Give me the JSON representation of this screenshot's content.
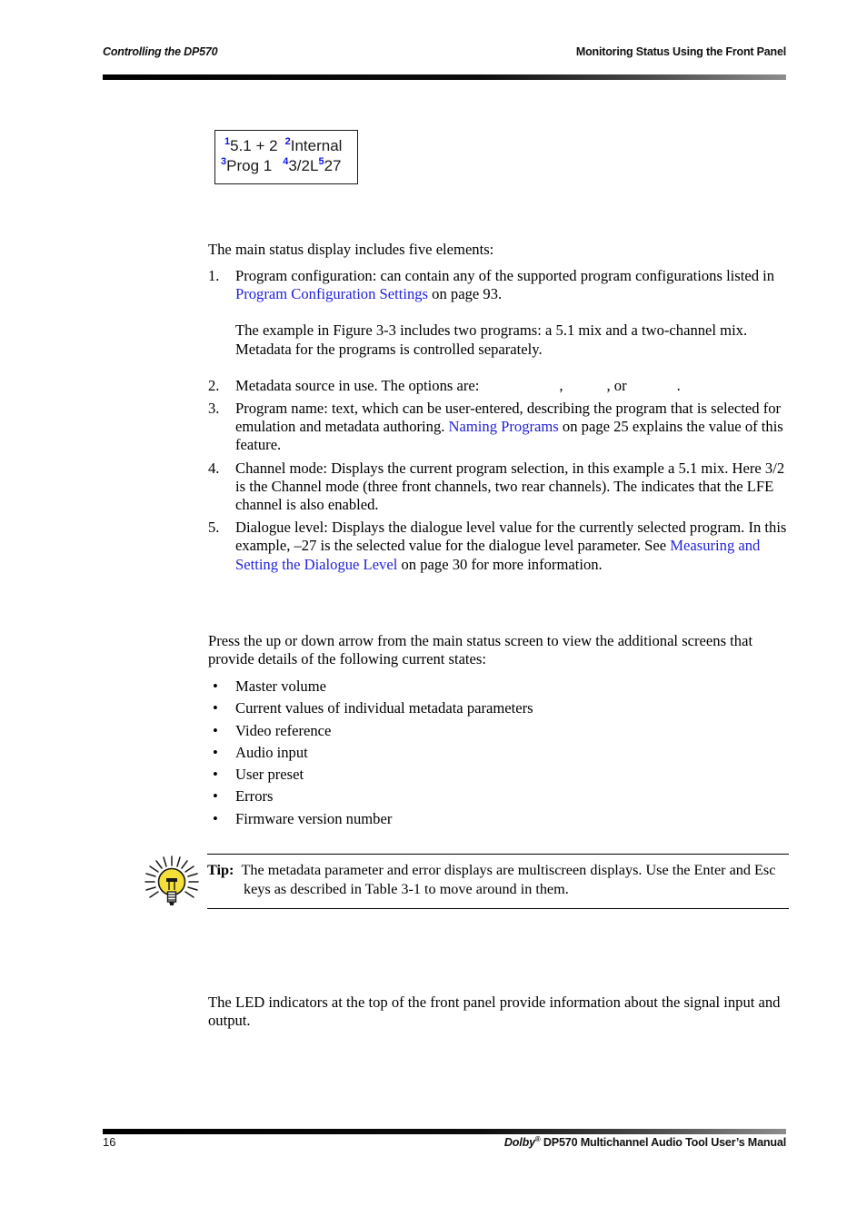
{
  "header": {
    "left": "Controlling the DP570",
    "right": "Monitoring Status Using the Front Panel"
  },
  "figure": {
    "name": "main-status-display",
    "line1": {
      "callout1": "1",
      "text1": "5.1 + 2",
      "callout2": "2",
      "text2": "Internal"
    },
    "line2": {
      "callout3": "3",
      "text3": "Prog 1",
      "callout4": "4",
      "text4": "3/2L",
      "callout5": "5",
      "text5": "27"
    }
  },
  "lead_in": "The main status display includes five elements:",
  "numbered_list": [
    {
      "num": "1.",
      "text_before_link": "Program configuration: can contain any of the supported program configurations listed in ",
      "link": "Program Configuration Settings",
      "text_after_link": " on page 93.",
      "sub_paragraph": "The example in Figure 3-3 includes two programs: a 5.1 mix and a two-channel mix. Metadata for the programs is controlled separately."
    },
    {
      "num": "2.",
      "text_before_link": "Metadata source in use. The options are:",
      "option1": "",
      "separator1": ",",
      "option2": "",
      "separator2": ", or",
      "option3": "",
      "terminator": "."
    },
    {
      "num": "3.",
      "text_before_link": "Program name: text, which can be user-entered, describing the program that is selected for emulation and metadata authoring. ",
      "link": "Naming Programs",
      "text_after_link": " on page 25 explains the value of this feature."
    },
    {
      "num": "4.",
      "text_before_link": "Channel mode: Displays the current program selection, in this example a 5.1 mix. Here 3/2 is the Channel mode (three front channels, two rear channels). The ",
      "text_after_link": " indicates that the LFE channel is also enabled."
    },
    {
      "num": "5.",
      "text_before_link": "Dialogue level: Displays the dialogue level value for the currently selected program. In this example, –27 is the selected value for the dialogue level parameter. See ",
      "link": "Measuring and Setting the Dialogue Level",
      "text_after_link": " on page 30 for more information."
    }
  ],
  "screens_paragraph": "Press the up or down arrow from the main status screen to view the additional screens that provide details of the following current states:",
  "bullets": [
    {
      "bullet": "•",
      "label": "Master volume"
    },
    {
      "bullet": "•",
      "label": "Current values of individual metadata parameters"
    },
    {
      "bullet": "•",
      "label": "Video reference"
    },
    {
      "bullet": "•",
      "label": "Audio input"
    },
    {
      "bullet": "•",
      "label": "User preset"
    },
    {
      "bullet": "•",
      "label": "Errors"
    },
    {
      "bullet": "•",
      "label": "Firmware version number"
    }
  ],
  "tip": {
    "label": "Tip:",
    "text": "The metadata parameter and error displays are multiscreen displays. Use the Enter and Esc keys as described in Table 3-1 to move around in them.",
    "icon": "lightbulb-icon"
  },
  "led_paragraph": "The LED indicators at the top of the front panel provide information about the signal input and output.",
  "footer": {
    "page_number": "16",
    "brand": "Dolby",
    "registered_mark": "®",
    "title": " DP570 Multichannel Audio Tool User’s Manual"
  },
  "colors": {
    "link": "#2222dd",
    "callout": "#0d14e8",
    "bulb": "#f5e03a",
    "rule": "#000000"
  }
}
